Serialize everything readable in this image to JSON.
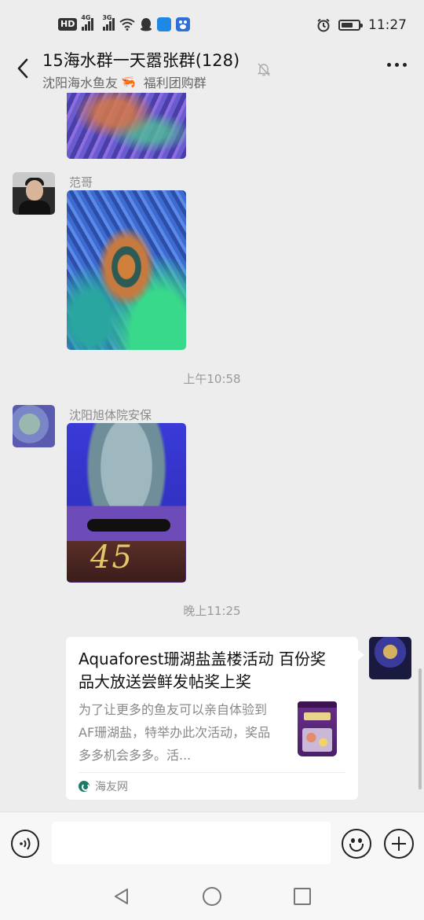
{
  "status_bar": {
    "time": "11:27",
    "hd_badge": "HD",
    "signal_1_label": "4G",
    "signal_2_label": "3G",
    "battery_level": 0.7
  },
  "header": {
    "title": "15海水群一天嚣张群(128)",
    "subtitle_left": "沈阳海水鱼友",
    "subtitle_emoji": "🦐",
    "subtitle_right": "福利团购群"
  },
  "messages": [
    {
      "sender": "范哥",
      "type": "image"
    },
    {
      "timestamp": "上午10:58"
    },
    {
      "sender": "沈阳旭体院安保",
      "type": "image",
      "image_text": "45"
    },
    {
      "timestamp": "晚上11:25"
    }
  ],
  "link_card": {
    "title": "Aquaforest珊湖盐盖楼活动 百份奖品大放送尝鲜发帖奖上奖",
    "description": "为了让更多的鱼友可以亲自体验到AF珊湖盐，特举办此次活动，奖品多多机会多多。活...",
    "source": "海友网"
  },
  "input": {
    "value": "",
    "placeholder": ""
  }
}
